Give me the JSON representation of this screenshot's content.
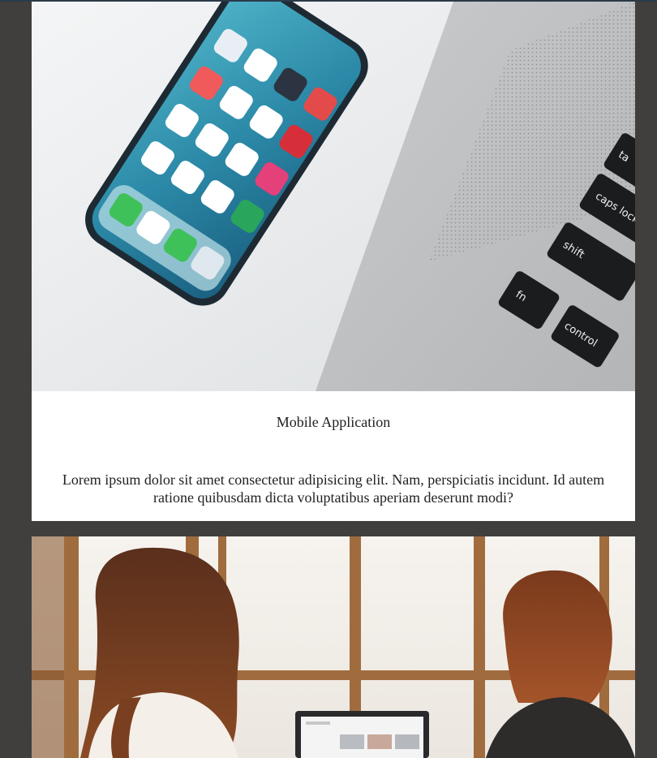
{
  "cards": [
    {
      "image": {
        "description_icon": "phone-and-laptop-photo",
        "keys": [
          "fn",
          "shift",
          "caps lock",
          "control",
          "ta"
        ]
      },
      "title": "Mobile Application",
      "description": "Lorem ipsum dolor sit amet consectetur adipisicing elit. Nam, perspiciatis incidunt. Id autem ratione quibusdam dicta voluptatibus aperiam deserunt modi?"
    },
    {
      "image": {
        "description_icon": "two-women-at-laptop-photo"
      }
    }
  ],
  "colors": {
    "page_background": "#413f3d",
    "card_background": "#ffffff",
    "text": "#222222"
  }
}
